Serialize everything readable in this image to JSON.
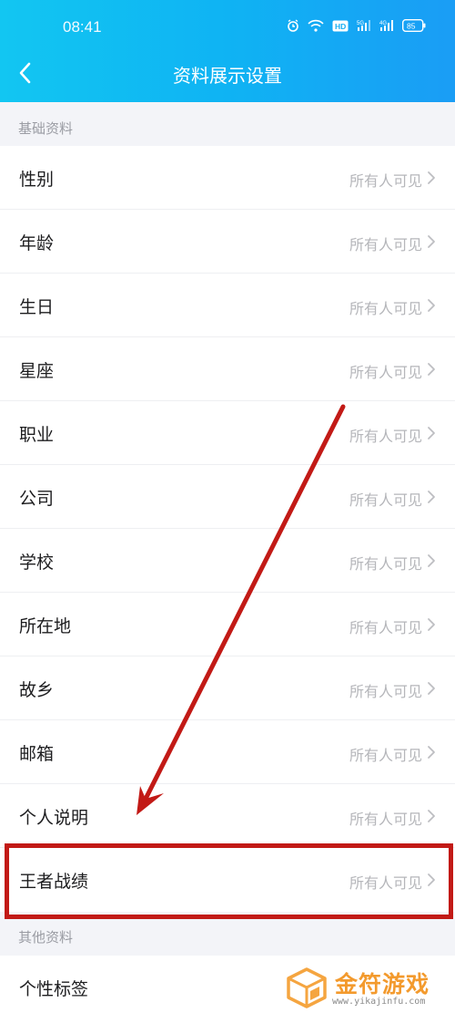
{
  "status_bar": {
    "time": "08:41",
    "icons": [
      "alarm-icon",
      "wifi-icon",
      "hd-icon",
      "signal-5g-icon",
      "signal-4g-icon",
      "battery-icon"
    ],
    "hd_label": "HD",
    "net1": "5G",
    "net2": "4G",
    "battery": "85"
  },
  "nav": {
    "title": "资料展示设置",
    "back_icon": "chevron-left-icon"
  },
  "sections": [
    {
      "title": "基础资料",
      "items": [
        {
          "label": "性别",
          "value": "所有人可见"
        },
        {
          "label": "年龄",
          "value": "所有人可见"
        },
        {
          "label": "生日",
          "value": "所有人可见"
        },
        {
          "label": "星座",
          "value": "所有人可见"
        },
        {
          "label": "职业",
          "value": "所有人可见"
        },
        {
          "label": "公司",
          "value": "所有人可见"
        },
        {
          "label": "学校",
          "value": "所有人可见"
        },
        {
          "label": "所在地",
          "value": "所有人可见"
        },
        {
          "label": "故乡",
          "value": "所有人可见"
        },
        {
          "label": "邮箱",
          "value": "所有人可见"
        },
        {
          "label": "个人说明",
          "value": "所有人可见"
        },
        {
          "label": "王者战绩",
          "value": "所有人可见"
        }
      ]
    },
    {
      "title": "其他资料",
      "items": [
        {
          "label": "个性标签",
          "value": ""
        }
      ]
    }
  ],
  "annotation": {
    "highlighted_item": "王者战绩",
    "color": "#c21a16"
  },
  "watermark": {
    "brand": "金符游戏",
    "url": "www.yikajinfu.com",
    "color": "#f39a2d"
  }
}
